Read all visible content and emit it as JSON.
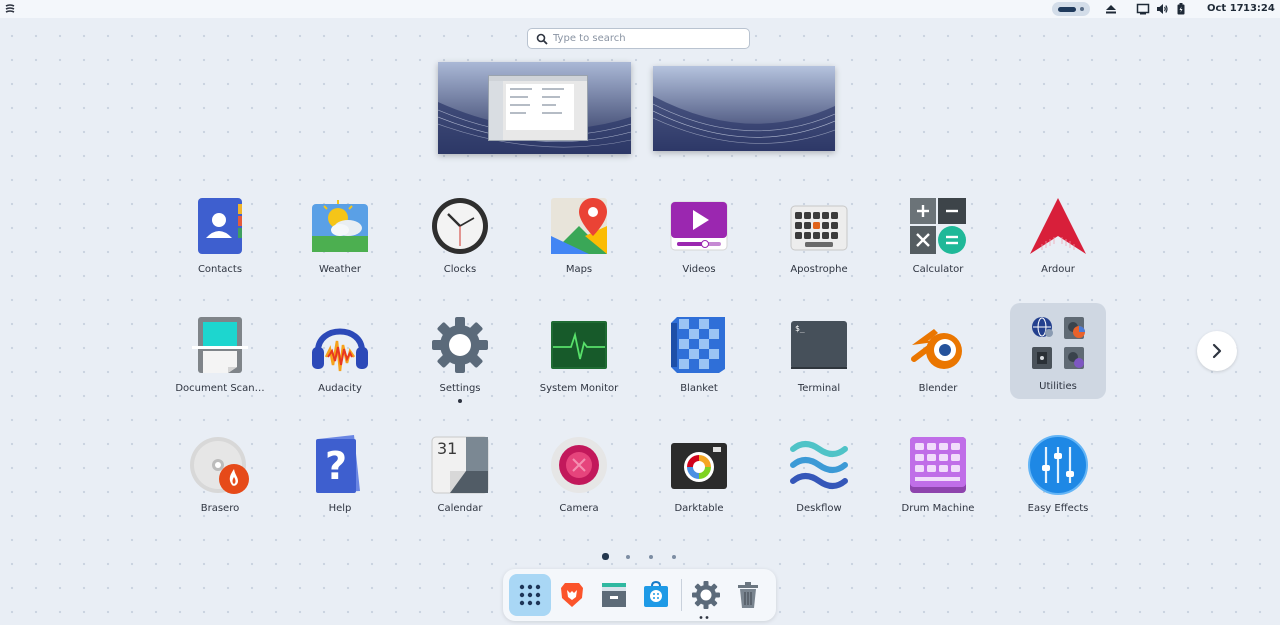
{
  "topbar": {
    "date": "Oct 17",
    "time": "13:24",
    "icons": [
      "activities-logo-icon",
      "workspace-indicator",
      "eject-icon",
      "screen-icon",
      "volume-icon",
      "battery-icon"
    ]
  },
  "search": {
    "placeholder": "Type to search",
    "value": ""
  },
  "workspaces": [
    "workspace-1",
    "workspace-2"
  ],
  "apps": [
    {
      "label": "Contacts",
      "icon": "contacts-icon"
    },
    {
      "label": "Weather",
      "icon": "weather-icon"
    },
    {
      "label": "Clocks",
      "icon": "clocks-icon"
    },
    {
      "label": "Maps",
      "icon": "maps-icon"
    },
    {
      "label": "Videos",
      "icon": "videos-icon"
    },
    {
      "label": "Apostrophe",
      "icon": "apostrophe-icon"
    },
    {
      "label": "Calculator",
      "icon": "calculator-icon"
    },
    {
      "label": "Ardour",
      "icon": "ardour-icon"
    },
    {
      "label": "Document Scan…",
      "icon": "document-scanner-icon"
    },
    {
      "label": "Audacity",
      "icon": "audacity-icon"
    },
    {
      "label": "Settings",
      "icon": "settings-icon",
      "running": true
    },
    {
      "label": "System Monitor",
      "icon": "system-monitor-icon"
    },
    {
      "label": "Blanket",
      "icon": "blanket-icon"
    },
    {
      "label": "Terminal",
      "icon": "terminal-icon"
    },
    {
      "label": "Blender",
      "icon": "blender-icon"
    },
    {
      "label": "Utilities",
      "icon": "utilities-folder-icon",
      "selected": true
    },
    {
      "label": "Brasero",
      "icon": "brasero-icon"
    },
    {
      "label": "Help",
      "icon": "help-icon"
    },
    {
      "label": "Calendar",
      "icon": "calendar-icon"
    },
    {
      "label": "Camera",
      "icon": "camera-icon"
    },
    {
      "label": "Darktable",
      "icon": "darktable-icon"
    },
    {
      "label": "Deskflow",
      "icon": "deskflow-icon"
    },
    {
      "label": "Drum Machine",
      "icon": "drum-machine-icon"
    },
    {
      "label": "Easy Effects",
      "icon": "easy-effects-icon"
    }
  ],
  "calendar_day": "31",
  "terminal_prompt": "$_",
  "pager": {
    "pages": 4,
    "current": 1
  },
  "dock": {
    "items": [
      "app-grid-icon",
      "brave-browser-icon",
      "files-icon",
      "software-store-icon",
      "settings-icon",
      "trash-icon"
    ]
  },
  "colors": {
    "background": "#e9eef5",
    "dock_active": "#a9d7f5",
    "accent_dark": "#24384f"
  }
}
